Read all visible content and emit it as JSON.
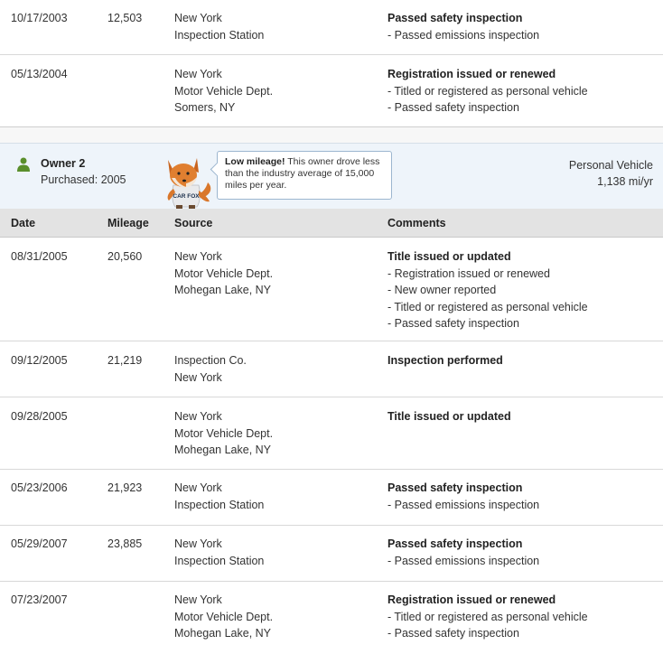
{
  "prior_records": [
    {
      "date": "10/17/2003",
      "mileage": "12,503",
      "source": [
        "New York",
        "Inspection Station"
      ],
      "comments": {
        "title": "Passed safety inspection",
        "items": [
          "- Passed emissions inspection"
        ]
      }
    },
    {
      "date": "05/13/2004",
      "mileage": "",
      "source": [
        "New York",
        "Motor Vehicle Dept.",
        "Somers, NY"
      ],
      "comments": {
        "title": "Registration issued or renewed",
        "items": [
          "- Titled or registered as personal vehicle",
          "- Passed safety inspection"
        ]
      }
    }
  ],
  "owner": {
    "name": "Owner 2",
    "purchased": "Purchased: 2005",
    "bubble_bold": "Low mileage!",
    "bubble_text": " This owner drove less than the industry average of 15,000 miles per year.",
    "vehicle_type": "Personal Vehicle",
    "miles_per_year": "1,138 mi/yr",
    "mascot_shirt": "CAR FOX",
    "colors": {
      "person_icon": "#5a8f2c",
      "bubble_border": "#9cb6cf",
      "band_bg": "#eef4fa"
    }
  },
  "table_headers": {
    "date": "Date",
    "mileage": "Mileage",
    "source": "Source",
    "comments": "Comments"
  },
  "records": [
    {
      "date": "08/31/2005",
      "mileage": "20,560",
      "source": [
        "New York",
        "Motor Vehicle Dept.",
        "Mohegan Lake, NY"
      ],
      "comments": {
        "title": "Title issued or updated",
        "items": [
          "- Registration issued or renewed",
          "- New owner reported",
          "- Titled or registered as personal vehicle",
          "- Passed safety inspection"
        ]
      }
    },
    {
      "date": "09/12/2005",
      "mileage": "21,219",
      "source": [
        "Inspection Co.",
        "New York"
      ],
      "comments": {
        "title": "Inspection performed",
        "items": []
      }
    },
    {
      "date": "09/28/2005",
      "mileage": "",
      "source": [
        "New York",
        "Motor Vehicle Dept.",
        "Mohegan Lake, NY"
      ],
      "comments": {
        "title": "Title issued or updated",
        "items": []
      }
    },
    {
      "date": "05/23/2006",
      "mileage": "21,923",
      "source": [
        "New York",
        "Inspection Station"
      ],
      "comments": {
        "title": "Passed safety inspection",
        "items": [
          "- Passed emissions inspection"
        ]
      }
    },
    {
      "date": "05/29/2007",
      "mileage": "23,885",
      "source": [
        "New York",
        "Inspection Station"
      ],
      "comments": {
        "title": "Passed safety inspection",
        "items": [
          "- Passed emissions inspection"
        ]
      }
    },
    {
      "date": "07/23/2007",
      "mileage": "",
      "source": [
        "New York",
        "Motor Vehicle Dept.",
        "Mohegan Lake, NY"
      ],
      "comments": {
        "title": "Registration issued or renewed",
        "items": [
          "- Titled or registered as personal vehicle",
          "- Passed safety inspection"
        ]
      }
    }
  ]
}
